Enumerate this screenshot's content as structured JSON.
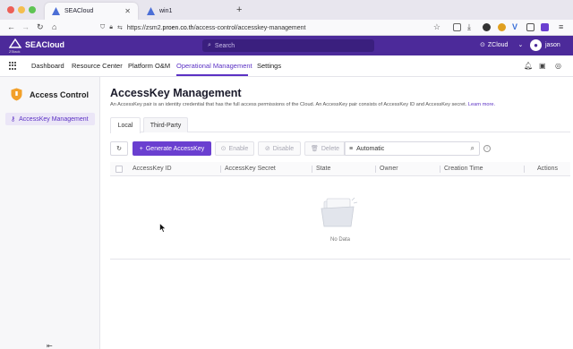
{
  "browser": {
    "tabs": [
      {
        "label": "SEACloud",
        "active": true
      },
      {
        "label": "win1",
        "active": false
      }
    ],
    "url_prefix": "https://zsm2.",
    "url_domain": "proen.co.th",
    "url_path": "/access-control/accesskey-management"
  },
  "app": {
    "brand": "SEACloud",
    "logo_sub": "ZStack",
    "search_placeholder": "Search",
    "zone": "ZCloud",
    "user": "jason",
    "colors": {
      "header": "#4c2a9a",
      "accent": "#5b31c4",
      "primary_button": "#6a3fd0"
    }
  },
  "topnav": {
    "items": [
      "Dashboard",
      "Resource Center",
      "Platform O&M",
      "Operational Management",
      "Settings"
    ],
    "active": "Operational Management"
  },
  "sidebar": {
    "title": "Access Control",
    "items": [
      {
        "label": "AccessKey Management",
        "icon": "key-icon",
        "active": true
      }
    ]
  },
  "page": {
    "title": "AccessKey Management",
    "description": "An AccessKey pair is an identity credential that has the full access permissions of the Cloud. An AccessKey pair consists of AccessKey ID and AccessKey secret.",
    "learn_more": "Learn more.",
    "tabs": [
      "Local",
      "Third-Party"
    ],
    "active_tab": "Local"
  },
  "toolbar": {
    "generate_label": "Generate AccessKey",
    "enable_label": "Enable",
    "disable_label": "Disable",
    "delete_label": "Delete",
    "filter_value": "Automatic"
  },
  "table": {
    "columns": [
      "AccessKey ID",
      "AccessKey Secret",
      "State",
      "Owner",
      "Creation Time",
      "Actions"
    ],
    "rows": [],
    "empty_text": "No Data"
  }
}
